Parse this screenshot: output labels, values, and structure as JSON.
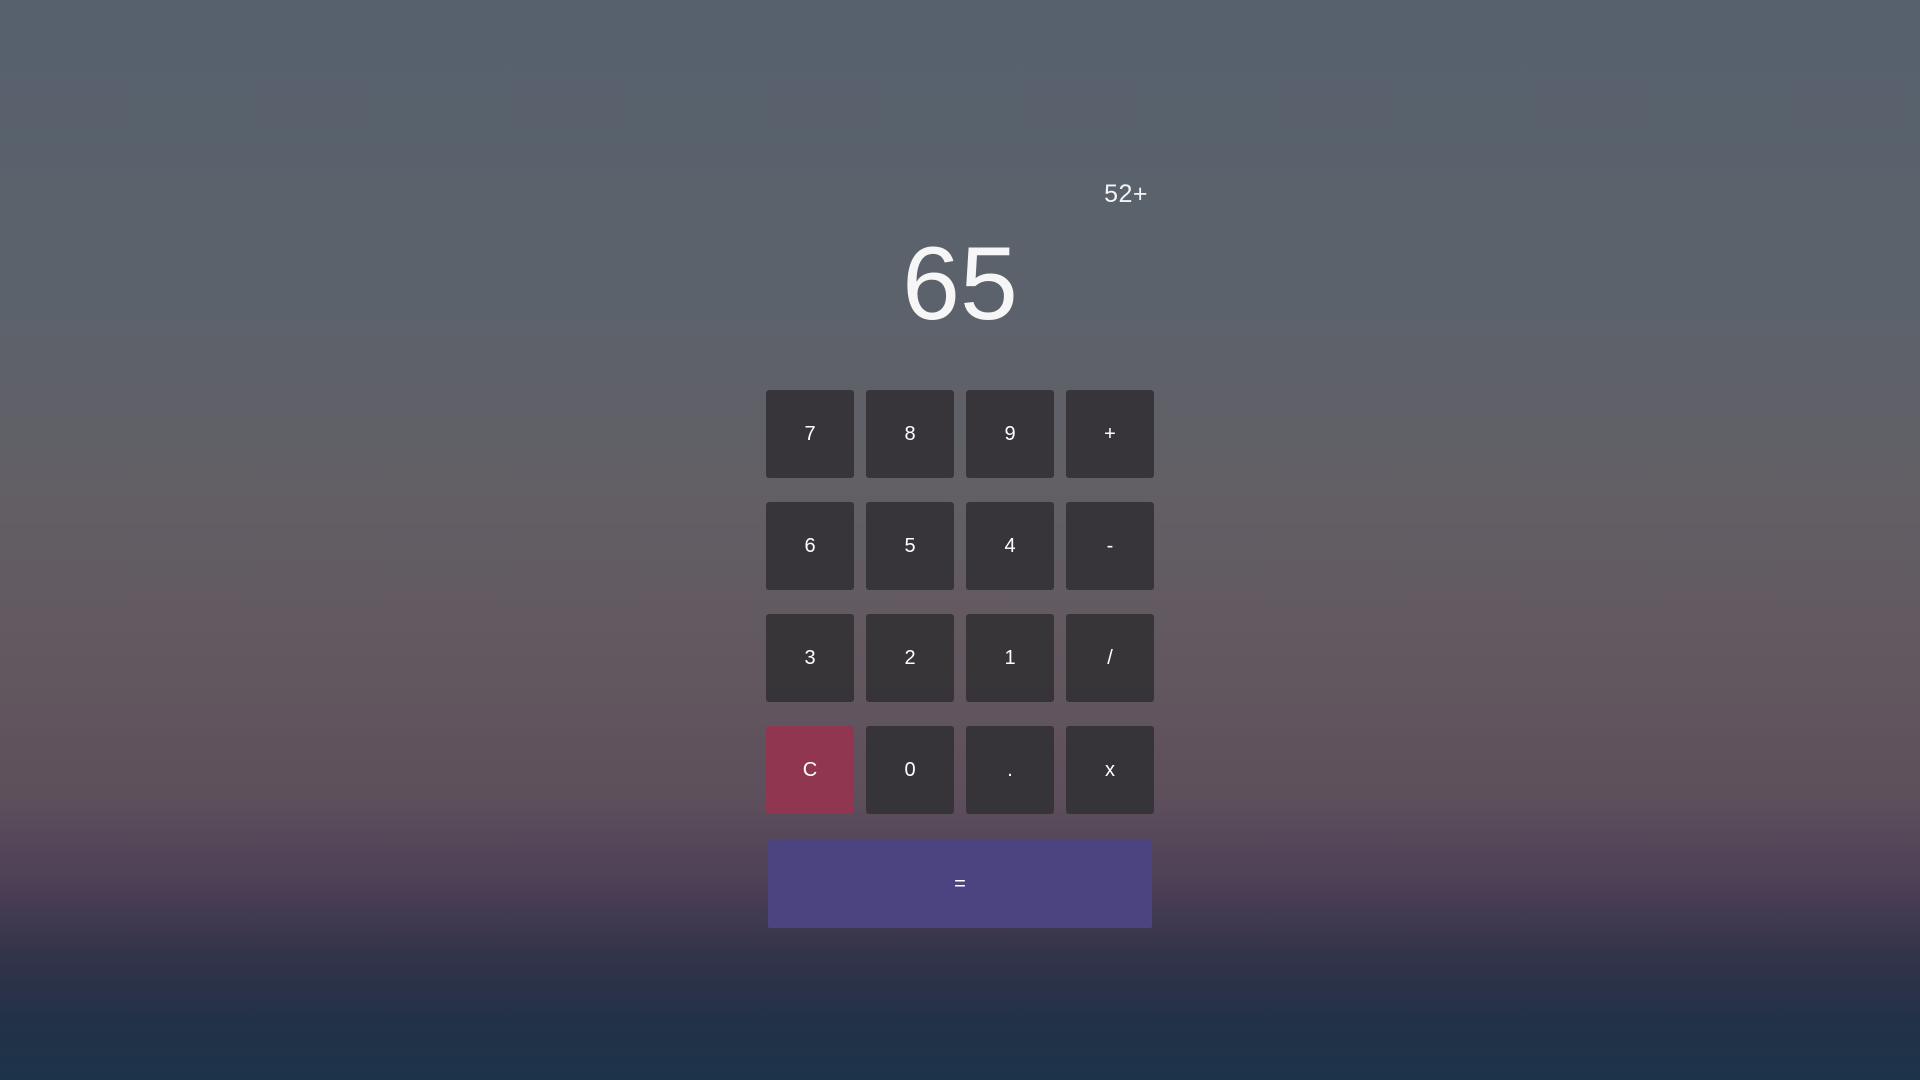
{
  "display": {
    "expression": "52+",
    "result": "65"
  },
  "keys": {
    "k7": "7",
    "k8": "8",
    "k9": "9",
    "plus": "+",
    "k6": "6",
    "k5": "5",
    "k4": "4",
    "minus": "-",
    "k3": "3",
    "k2": "2",
    "k1": "1",
    "divide": "/",
    "clear": "C",
    "k0": "0",
    "decimal": ".",
    "multiply": "x",
    "equals": "="
  },
  "colors": {
    "key_bg": "#363438",
    "clear_bg": "#903651",
    "equals_bg": "#4c4480",
    "text": "#ffffff"
  }
}
